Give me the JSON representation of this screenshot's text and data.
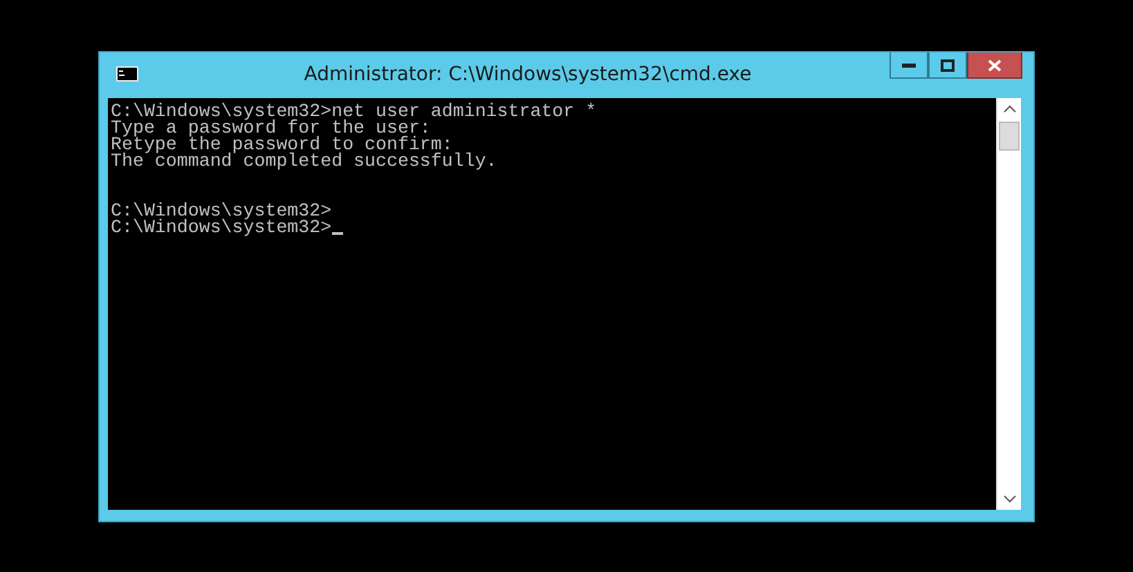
{
  "window": {
    "title": "Administrator: C:\\Windows\\system32\\cmd.exe"
  },
  "console": {
    "blocks": [
      [
        "C:\\Windows\\system32>net user administrator *",
        "Type a password for the user:",
        "Retype the password to confirm:",
        "The command completed successfully."
      ],
      [
        "C:\\Windows\\system32>",
        "C:\\Windows\\system32>"
      ]
    ],
    "cursor": true
  }
}
